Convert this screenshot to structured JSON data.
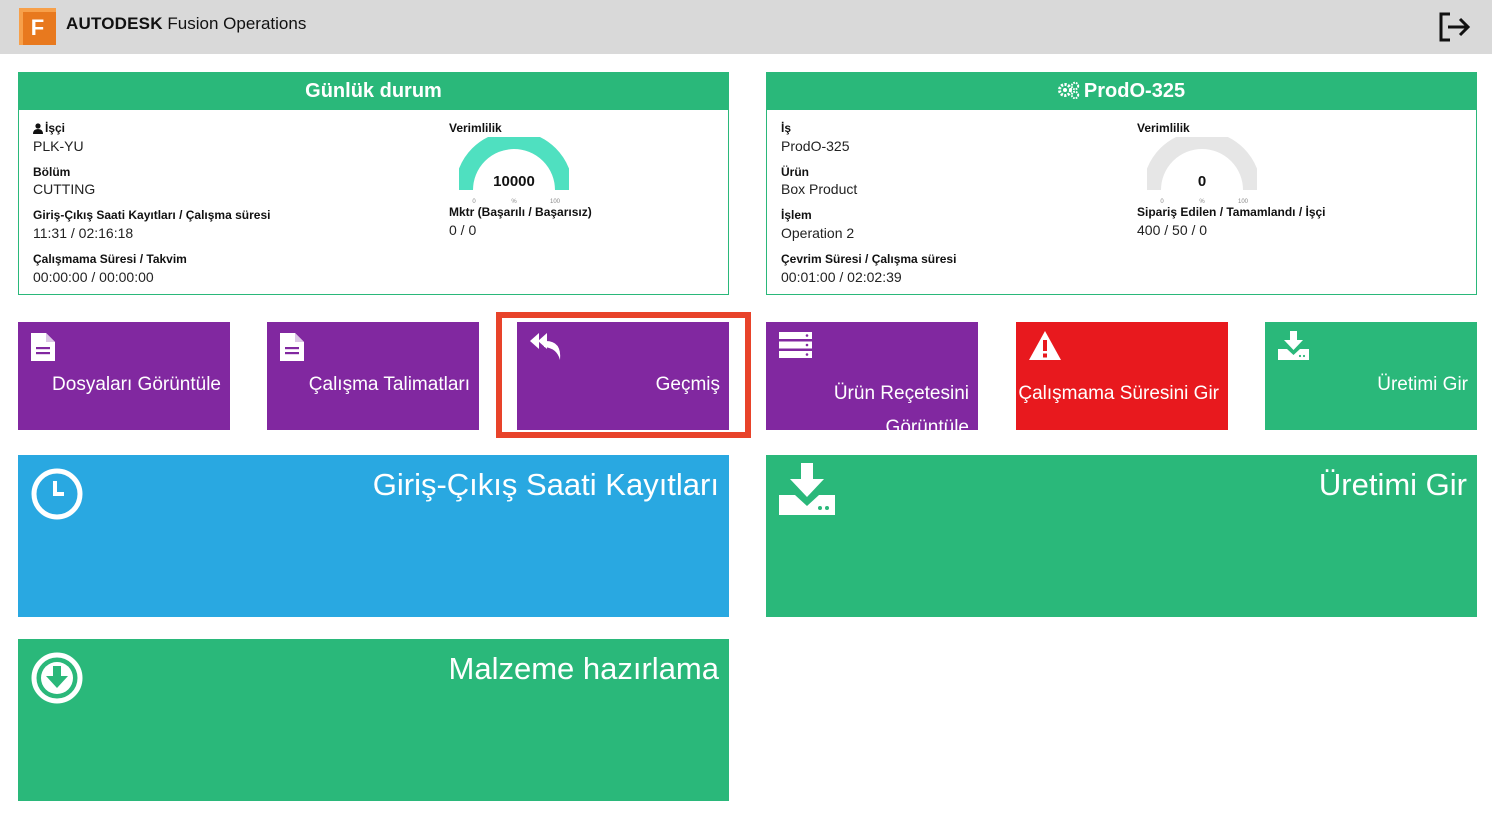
{
  "app": {
    "brand": "AUTODESK",
    "product": " Fusion Operations",
    "logo_letter": "F",
    "logout_icon": "logout-icon"
  },
  "daily_status": {
    "title": "Günlük durum",
    "worker_label": "İşçi",
    "worker_value": "PLK-YU",
    "department_label": "Bölüm",
    "department_value": "CUTTING",
    "clock_label": "Giriş-Çıkış Saati Kayıtları / Çalışma süresi",
    "clock_value": "11:31 / 02:16:18",
    "downtime_label": "Çalışmama Süresi / Takvim",
    "downtime_value": "00:00:00 / 00:00:00",
    "efficiency_label": "Verimlilik",
    "efficiency_value": "10000",
    "efficiency_fraction": 1.0,
    "gauge_min": "0",
    "gauge_mid": "%",
    "gauge_max": "100",
    "qty_label": "Mktr (Başarılı / Başarısız)",
    "qty_value": "0 / 0"
  },
  "job": {
    "title": "ProdO-325",
    "job_label": "İş",
    "job_value": "ProdO-325",
    "product_label": "Ürün",
    "product_value": "Box Product",
    "operation_label": "İşlem",
    "operation_value": "Operation 2",
    "cycle_label": "Çevrim Süresi / Çalışma süresi",
    "cycle_value": "00:01:00 / 02:02:39",
    "efficiency_label": "Verimlilik",
    "efficiency_value": "0",
    "efficiency_fraction": 0.0,
    "gauge_min": "0",
    "gauge_mid": "%",
    "gauge_max": "100",
    "order_label": "Sipariş Edilen / Tamamlandı / İşçi",
    "order_value": "400 / 50 / 0"
  },
  "tiles": {
    "view_files": "Dosyaları Görüntüle",
    "work_instructions": "Çalışma Talimatları",
    "history": "Geçmiş",
    "view_recipe": "Ürün Reçetesini",
    "view_recipe_cont": "Görüntüle",
    "enter_downtime": "Çalışmama Süresini Gir",
    "enter_production_small": "Üretimi Gir",
    "clock_records": "Giriş-Çıkış Saati Kayıtları",
    "enter_production_big": "Üretimi Gir",
    "material_prep": "Malzeme hazırlama"
  },
  "colors": {
    "green": "#2ab87a",
    "purple": "#8128a0",
    "red": "#e8191e",
    "blue": "#29a8e1",
    "highlight": "#e8432a",
    "gauge_fill": "#4fe0c0",
    "gauge_empty": "#e6e6e6"
  }
}
